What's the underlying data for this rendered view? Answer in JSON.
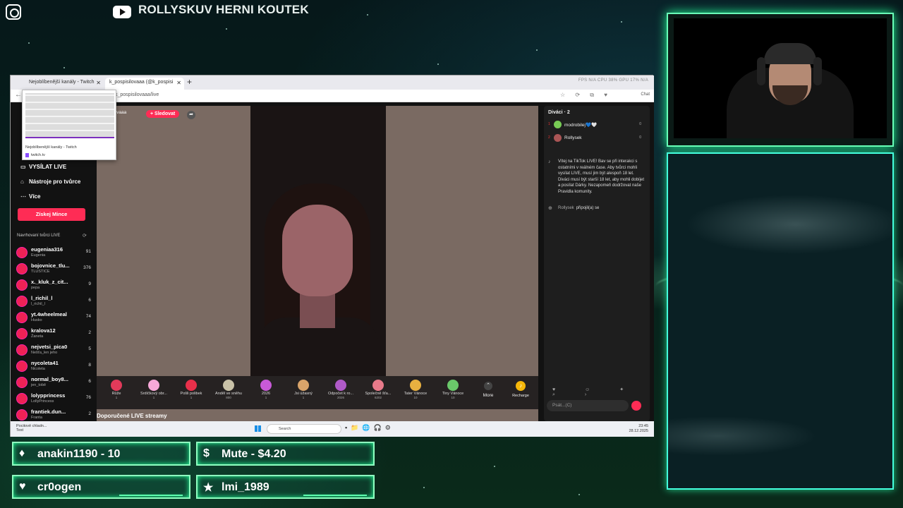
{
  "overlay": {
    "channel_name": "ROLLYSKUV HERNI KOUTEK",
    "alerts": [
      {
        "icon": "drop-icon",
        "label": "anakin1190 - 10"
      },
      {
        "icon": "dollar-icon",
        "label": "Mute - $4.20"
      },
      {
        "icon": "heart-icon",
        "label": "cr0ogen"
      },
      {
        "icon": "star-icon",
        "label": "lmi_1989"
      }
    ]
  },
  "browser": {
    "tabs": [
      {
        "title": "Nejoblíbenější kanály - Twitch"
      },
      {
        "title": "k_pospisilovaaa (@k_pospisi"
      }
    ],
    "url": "k_pospisilovaaa/live",
    "chat_button": "Chat",
    "stats": "FPS N/A  CPU 38%  GPU 17%  N/A",
    "preview": {
      "title": "Nejoblíbenější kanály - Twitch",
      "url": "twitch.tv"
    }
  },
  "sidebar": {
    "items": [
      {
        "label": "VYSÍLAT LIVE",
        "icon": "live-icon"
      },
      {
        "label": "Nástroje pro tvůrce",
        "icon": "home-icon"
      },
      {
        "label": "Více",
        "icon": "more-icon"
      }
    ],
    "coins_button": "Získej Mince",
    "suggested_heading": "Navrhovaní tvůrci LIVE",
    "creators": [
      {
        "name": "eugeniaa316",
        "sub": "Eugenia",
        "count": "91"
      },
      {
        "name": "bojovnice_tlu...",
        "sub": "TLUSTICE",
        "count": "376"
      },
      {
        "name": "x._kluk_z_cit...",
        "sub": "pepa",
        "count": "9"
      },
      {
        "name": "l_richil_l",
        "sub": "l_richil_l",
        "count": "6"
      },
      {
        "name": "yt.4wheelmeal",
        "sub": "Husko",
        "count": "74"
      },
      {
        "name": "kralova12",
        "sub": "Žaneta",
        "count": "2"
      },
      {
        "name": "nejvetsi_pica0",
        "sub": "Nešťa_len jeho",
        "count": "5"
      },
      {
        "name": "nycoleta41",
        "sub": "Nicoleta",
        "count": "8"
      },
      {
        "name": "normal_boy8...",
        "sub": "jen_tobě",
        "count": "6"
      },
      {
        "name": "lolypprincess",
        "sub": "LollyPrincess",
        "count": "76"
      },
      {
        "name": "frantiek.dun...",
        "sub": "Franta",
        "count": "2"
      }
    ]
  },
  "stream": {
    "host": "k_pospisilovaaa",
    "follow_label": "+ Sledovat",
    "gifts": [
      {
        "name": "Růže",
        "price": "1",
        "color": "#e23a5a"
      },
      {
        "name": "Srdíčkový obr...",
        "price": "1",
        "color": "#f7a8d8"
      },
      {
        "name": "Pošli polibek",
        "price": "1",
        "color": "#e8304a"
      },
      {
        "name": "Anděl ve sněhu",
        "price": "800",
        "color": "#c9c2a8"
      },
      {
        "name": "2026",
        "price": "1",
        "color": "#c85ad8"
      },
      {
        "name": "Jsi úžasný",
        "price": "1",
        "color": "#d9a46a"
      },
      {
        "name": "Odpočet k ro...",
        "price": "2026",
        "color": "#b05ac8"
      },
      {
        "name": "Společně šťa...",
        "price": "6202",
        "color": "#e87a8a"
      },
      {
        "name": "Tater Vánoce",
        "price": "10",
        "color": "#e8b040"
      },
      {
        "name": "Tiny Vánoce",
        "price": "10",
        "color": "#6ac86a"
      }
    ],
    "more_label": "More",
    "recharge_label": "Recharge",
    "recommended_heading": "Doporučené LIVE streamy"
  },
  "chat": {
    "viewers_heading": "Diváci · 2",
    "viewers": [
      {
        "rank": "1",
        "name": "modrobilej💙🤍",
        "score": "0"
      },
      {
        "rank": "2",
        "name": "Rollysek",
        "score": "0"
      }
    ],
    "welcome_text": "Vítej na TikTok LIVE! Bav se při interakci s ostatními v reálném čase. Aby tvůrci mohli vysílat LIVE, musí jim být alespoň 18 let. Diváci musí být starší 18 let, aby mohli dobíjet a posílat Dárky. Nezapomeň dodržovat naše Pravidla komunity.",
    "join_user": "Rollysek",
    "join_text": "připojil(a) se",
    "input_placeholder": "Psát...(C)"
  },
  "taskbar": {
    "weather_temp": "Pocitově chladn...",
    "weather_sub": "Test",
    "search_placeholder": "Search",
    "time": "23:45",
    "date": "28.12.2025"
  }
}
